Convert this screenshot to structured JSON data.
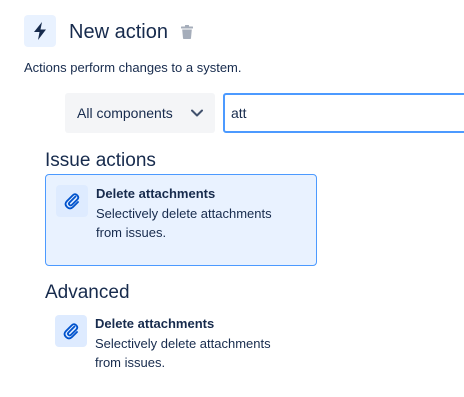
{
  "header": {
    "title": "New action",
    "subtitle": "Actions perform changes to a system.",
    "icon": "lightning-bolt-icon",
    "delete_icon": "trash-icon"
  },
  "filters": {
    "component_select": {
      "selected": "All components"
    },
    "search": {
      "value": "att"
    }
  },
  "sections": [
    {
      "heading": "Issue actions",
      "items": [
        {
          "title": "Delete attachments",
          "description": "Selectively delete attachments from issues.",
          "icon": "paperclip-icon",
          "selected": true
        }
      ]
    },
    {
      "heading": "Advanced",
      "items": [
        {
          "title": "Delete attachments",
          "description": "Selectively delete attachments from issues.",
          "icon": "paperclip-icon",
          "selected": false
        }
      ]
    }
  ],
  "colors": {
    "text": "#172b4d",
    "accent": "#0052cc",
    "selected_bg": "#e9f2ff",
    "selected_border": "#4c9aff"
  }
}
